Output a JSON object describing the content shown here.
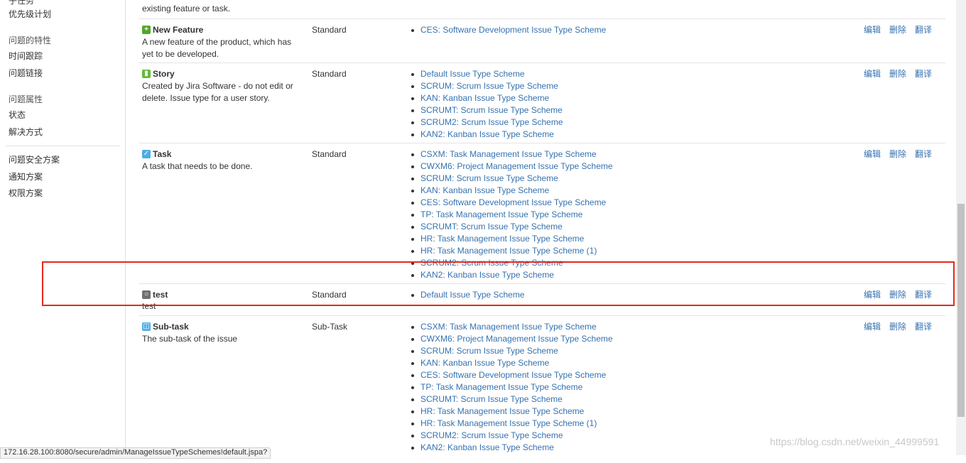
{
  "sidebar": {
    "partial_top": "子任务",
    "items": [
      {
        "label": "优先级计划",
        "kind": "item"
      },
      {
        "label": "问题的特性",
        "kind": "head"
      },
      {
        "label": "时间跟踪",
        "kind": "item"
      },
      {
        "label": "问题链接",
        "kind": "item"
      },
      {
        "label": "问题属性",
        "kind": "head"
      },
      {
        "label": "状态",
        "kind": "item"
      },
      {
        "label": "解决方式",
        "kind": "item"
      },
      {
        "label": "问题安全方案",
        "kind": "item"
      },
      {
        "label": "通知方案",
        "kind": "item"
      },
      {
        "label": "权限方案",
        "kind": "item"
      }
    ]
  },
  "partial_row": {
    "desc": "existing feature or task."
  },
  "ops": {
    "edit": "编辑",
    "delete": "删除",
    "translate": "翻译"
  },
  "issue_types": [
    {
      "name": "New Feature",
      "icon": "new-feature-icon",
      "color": "#51a825",
      "desc": "A new feature of the product, which has yet to be developed.",
      "type": "Standard",
      "schemes": [
        "CES: Software Development Issue Type Scheme"
      ]
    },
    {
      "name": "Story",
      "icon": "story-icon",
      "color": "#63ba3c",
      "desc": "Created by Jira Software - do not edit or delete. Issue type for a user story.",
      "type": "Standard",
      "schemes": [
        "Default Issue Type Scheme",
        "SCRUM: Scrum Issue Type Scheme",
        "KAN: Kanban Issue Type Scheme",
        "SCRUMT: Scrum Issue Type Scheme",
        "SCRUM2: Scrum Issue Type Scheme",
        "KAN2: Kanban Issue Type Scheme"
      ]
    },
    {
      "name": "Task",
      "icon": "task-checkbox-icon",
      "color": "#4bade8",
      "desc": "A task that needs to be done.",
      "type": "Standard",
      "schemes": [
        "CSXM: Task Management Issue Type Scheme",
        "CWXM6: Project Management Issue Type Scheme",
        "SCRUM: Scrum Issue Type Scheme",
        "KAN: Kanban Issue Type Scheme",
        "CES: Software Development Issue Type Scheme",
        "TP: Task Management Issue Type Scheme",
        "SCRUMT: Scrum Issue Type Scheme",
        "HR: Task Management Issue Type Scheme",
        "HR: Task Management Issue Type Scheme (1)",
        "SCRUM2: Scrum Issue Type Scheme",
        "KAN2: Kanban Issue Type Scheme"
      ]
    },
    {
      "name": "test",
      "icon": "generic-issue-icon",
      "color": "#707070",
      "desc": "test",
      "type": "Standard",
      "schemes": [
        "Default Issue Type Scheme"
      ]
    },
    {
      "name": "Sub-task",
      "icon": "subtask-icon",
      "color": "#4bade8",
      "desc": "The sub-task of the issue",
      "type": "Sub-Task",
      "schemes": [
        "CSXM: Task Management Issue Type Scheme",
        "CWXM6: Project Management Issue Type Scheme",
        "SCRUM: Scrum Issue Type Scheme",
        "KAN: Kanban Issue Type Scheme",
        "CES: Software Development Issue Type Scheme",
        "TP: Task Management Issue Type Scheme",
        "SCRUMT: Scrum Issue Type Scheme",
        "HR: Task Management Issue Type Scheme",
        "HR: Task Management Issue Type Scheme (1)",
        "SCRUM2: Scrum Issue Type Scheme",
        "KAN2: Kanban Issue Type Scheme"
      ]
    }
  ],
  "status_url": "172.16.28.100:8080/secure/admin/ManageIssueTypeSchemes!default.jspa?",
  "watermark": "https://blog.csdn.net/weixin_44999591"
}
